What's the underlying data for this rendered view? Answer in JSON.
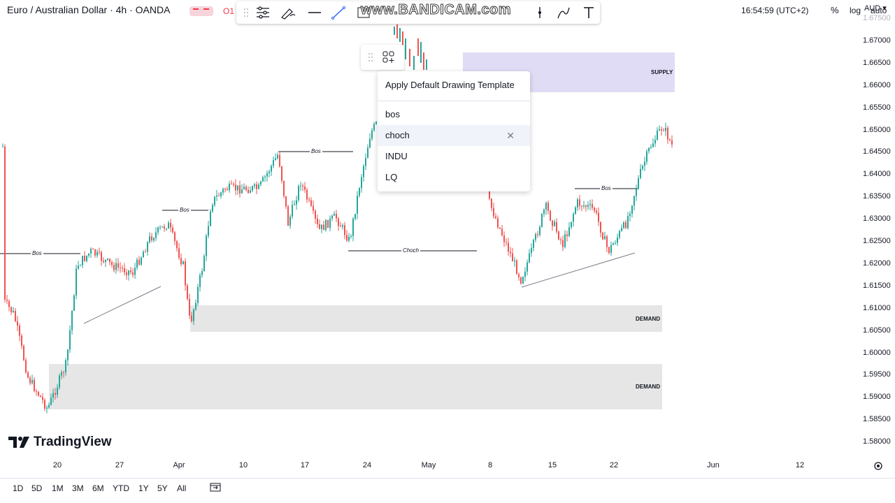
{
  "header": {
    "symbol_title": "Euro / Australian Dollar · 4h · OANDA",
    "ohlc_label": "O1"
  },
  "watermark": "www.BANDICAM.com",
  "toolbar_icons": [
    "drag-handle-icon",
    "template-icon",
    "brush-icon",
    "line-icon",
    "trendline-icon",
    "object-tree-icon",
    "magnet-icon",
    "path-icon",
    "text-icon"
  ],
  "template_popup": {
    "header": "Apply Default Drawing Template",
    "items": [
      {
        "label": "bos"
      },
      {
        "label": "choch"
      },
      {
        "label": "INDU"
      },
      {
        "label": "LQ"
      }
    ]
  },
  "price_axis": {
    "currency": "AUD",
    "labels": [
      "1.67500",
      "1.67000",
      "1.66500",
      "1.66000",
      "1.65500",
      "1.65000",
      "1.64500",
      "1.64000",
      "1.63500",
      "1.63000",
      "1.62500",
      "1.62000",
      "1.61500",
      "1.61000",
      "1.60500",
      "1.60000",
      "1.59500",
      "1.59000",
      "1.58500",
      "1.58000"
    ]
  },
  "time_axis": {
    "labels": [
      "20",
      "27",
      "Apr",
      "10",
      "17",
      "24",
      "May",
      "8",
      "15",
      "22",
      "Jun",
      "12"
    ]
  },
  "bottom_bar": {
    "ranges": [
      "1D",
      "5D",
      "1M",
      "3M",
      "6M",
      "YTD",
      "1Y",
      "5Y",
      "All"
    ],
    "clock": "16:54:59 (UTC+2)",
    "percent": "%",
    "log": "log",
    "auto": "auto"
  },
  "zones": {
    "supply": "SUPPLY",
    "demand_upper": "DEMAND",
    "demand_lower": "DEMAND"
  },
  "annotations": {
    "bos_1": "Bos",
    "bos_2": "Bos",
    "bos_3": "Bos",
    "bos_4": "Bos",
    "choch": "Choch"
  },
  "branding": {
    "logo_text": "TradingView"
  },
  "colors": {
    "up": "#26a69a",
    "down": "#ef5350",
    "supply": "#e1dcf5",
    "demand": "#e6e6e6"
  }
}
